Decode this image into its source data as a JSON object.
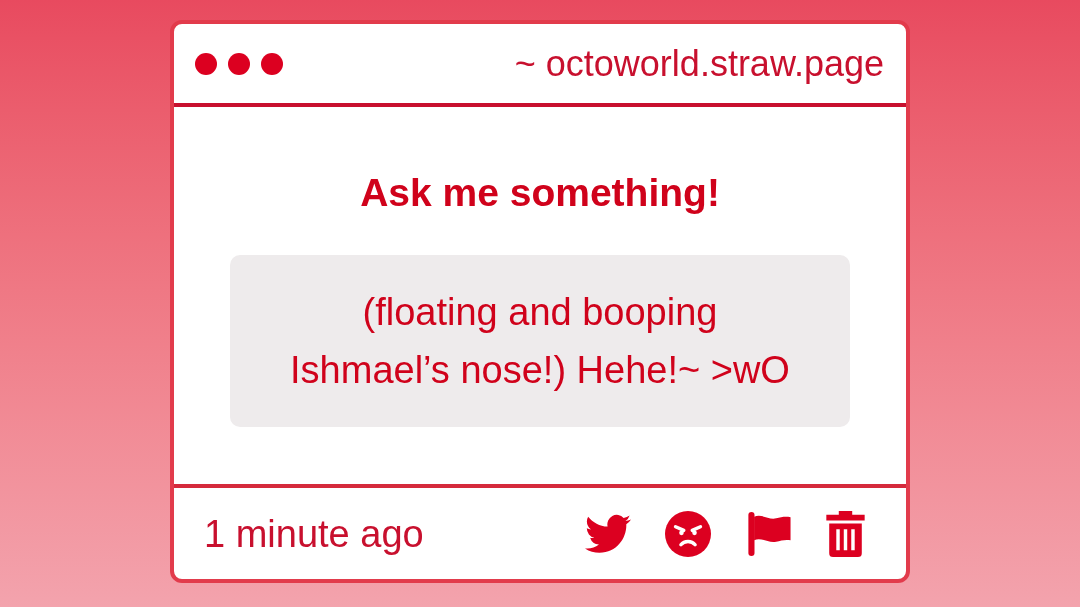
{
  "address_bar": {
    "url": "~ octoworld.straw.page"
  },
  "prompt": {
    "title": "Ask me something!"
  },
  "question": {
    "text": "(floating and booping Ishmael’s nose!) Hehe!~ >wO"
  },
  "footer": {
    "timestamp": "1 minute ago",
    "actions": [
      {
        "kind": "share"
      },
      {
        "kind": "block"
      },
      {
        "kind": "report"
      },
      {
        "kind": "delete"
      }
    ]
  }
}
